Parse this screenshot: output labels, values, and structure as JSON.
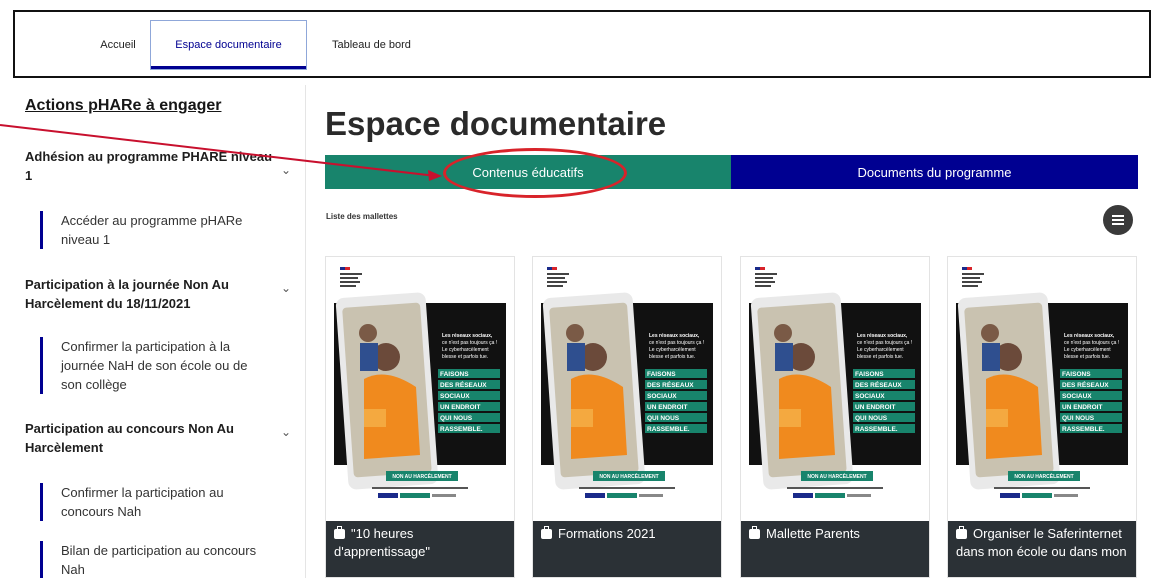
{
  "nav": {
    "tabs": [
      {
        "label": "Accueil"
      },
      {
        "label": "Espace documentaire",
        "active": true
      },
      {
        "label": "Tableau de bord"
      }
    ]
  },
  "sidebar": {
    "title": "Actions pHARe à engager",
    "sections": [
      {
        "title": "Adhésion au programme PHARE niveau 1",
        "links": [
          "Accéder au programme pHARe niveau 1"
        ]
      },
      {
        "title": "Participation à la journée Non Au Harcèlement du 18/11/2021",
        "links": [
          "Confirmer la participation à la journée NaH de son école ou de son collège"
        ]
      },
      {
        "title": "Participation au concours Non Au Harcèlement",
        "links": [
          "Confirmer la participation au concours Nah",
          "Bilan de participation au concours Nah"
        ]
      }
    ]
  },
  "main": {
    "title": "Espace documentaire",
    "tabs": [
      {
        "label": "Contenus éducatifs",
        "color": "#18846c",
        "highlighted": true
      },
      {
        "label": "Documents du programme",
        "color": "#000091"
      }
    ],
    "list_label": "Liste des mallettes",
    "menu_icon": "hamburger-icon",
    "poster": {
      "intro": "Les réseaux sociaux, ce n'est pas toujours ça ! Le cyberharcèlement blesse et parfois tue.",
      "headline": [
        "FAISONS",
        "DES RÉSEAUX",
        "SOCIAUX",
        "UN ENDROIT",
        "QUI NOUS",
        "RASSEMBLE."
      ],
      "badge": "NON AU HARCÈLEMENT"
    },
    "cards": [
      {
        "title": "\"10 heures d'apprentissage\"",
        "icon": "briefcase-icon"
      },
      {
        "title": "Formations 2021",
        "icon": "briefcase-icon"
      },
      {
        "title": "Mallette Parents",
        "icon": "briefcase-icon"
      },
      {
        "title": "Organiser le Saferinternet dans mon école ou dans mon",
        "icon": "briefcase-icon"
      }
    ]
  },
  "colors": {
    "accent_green": "#18846c",
    "accent_blue": "#000091",
    "annotation_red": "#d8232a",
    "caption_bg": "#2b3136"
  }
}
